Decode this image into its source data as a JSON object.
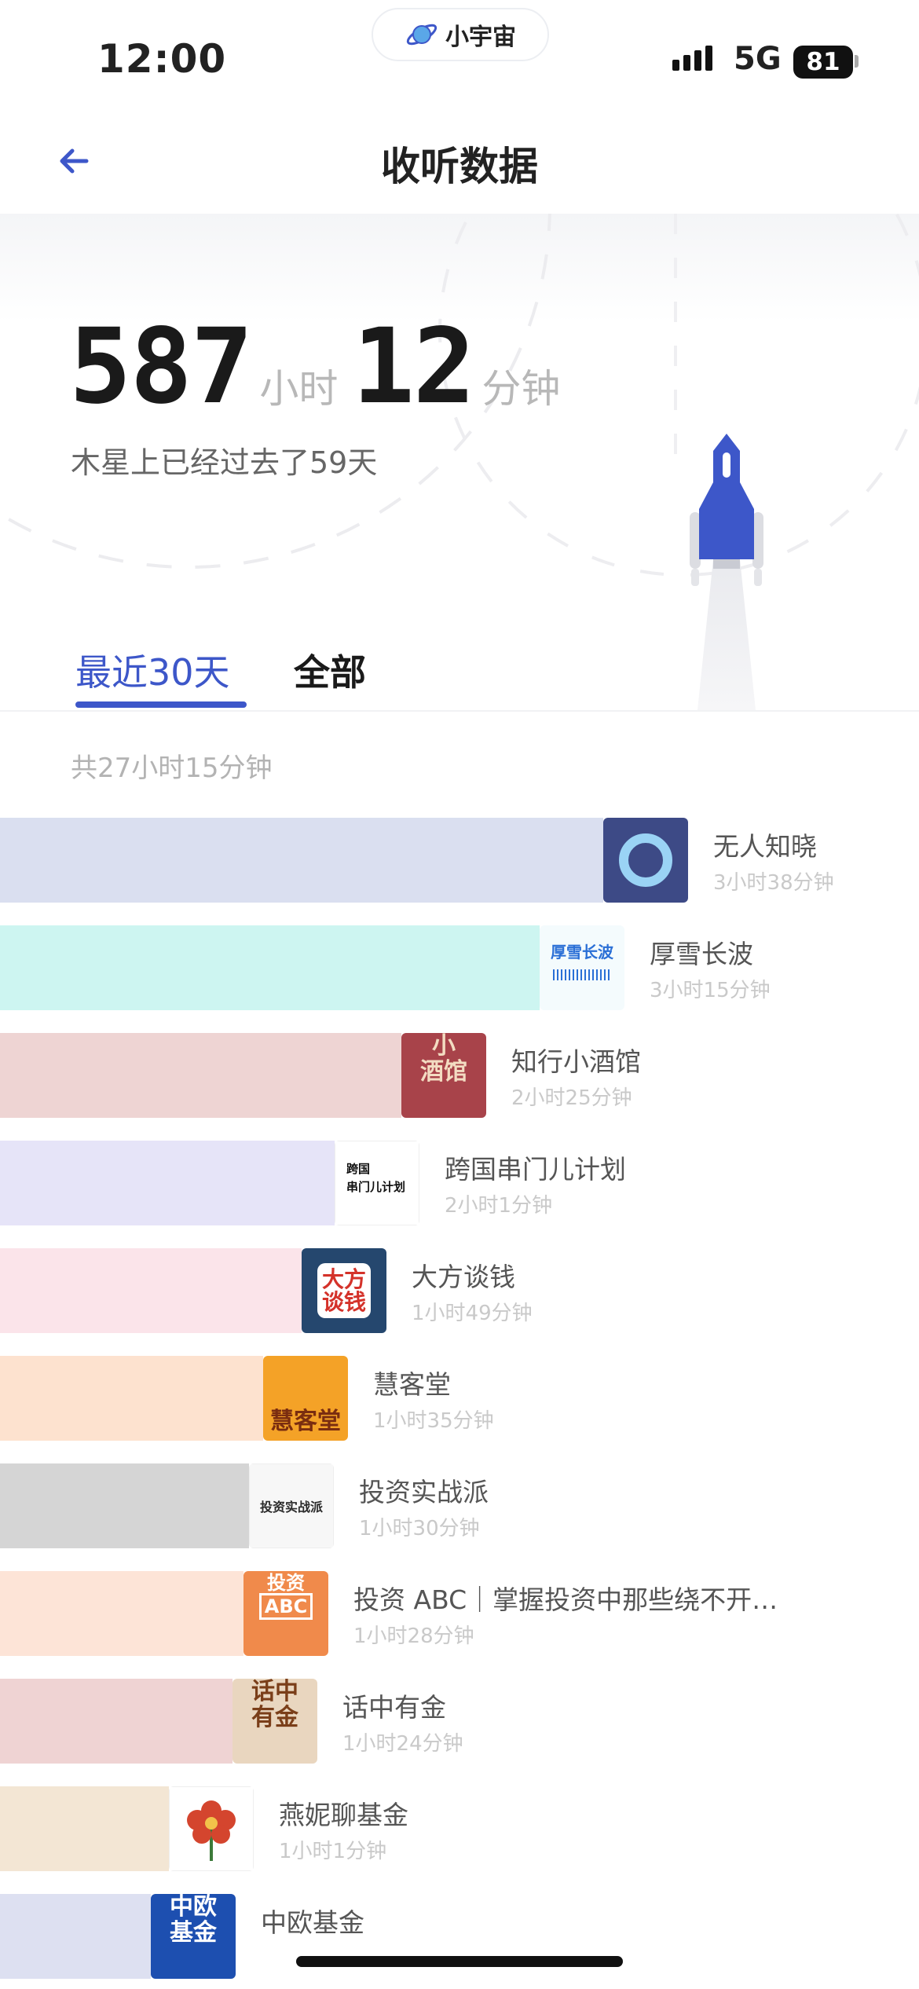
{
  "status": {
    "time": "12:00",
    "network": "5G",
    "battery": "81"
  },
  "island": {
    "app_name": "小宇宙"
  },
  "nav": {
    "title": "收听数据"
  },
  "summary": {
    "hours": "587",
    "hours_unit": "小时",
    "minutes": "12",
    "minutes_unit": "分钟",
    "subtitle": "木星上已经过去了59天"
  },
  "tabs": [
    {
      "label": "最近30天",
      "active": true
    },
    {
      "label": "全部",
      "active": false
    }
  ],
  "total": "共27小时15分钟",
  "podcasts": [
    {
      "name": "无人知晓",
      "duration": "3小时38分钟",
      "share": 1.0,
      "bar_color": "#dadff0",
      "cover": "halo"
    },
    {
      "name": "厚雪长波",
      "duration": "3小时15分钟",
      "share": 0.894,
      "bar_color": "#cdf5f1",
      "cover": "厚雪长波"
    },
    {
      "name": "知行小酒馆",
      "duration": "2小时25分钟",
      "share": 0.665,
      "bar_color": "#eed4d3",
      "cover": "小酒馆"
    },
    {
      "name": "跨国串门儿计划",
      "duration": "2小时1分钟",
      "share": 0.555,
      "bar_color": "#e6e4f8",
      "cover": "跨国串门儿计划"
    },
    {
      "name": "大方谈钱",
      "duration": "1小时49分钟",
      "share": 0.5,
      "bar_color": "#fbe4ea",
      "cover": "大方谈钱"
    },
    {
      "name": "慧客堂",
      "duration": "1小时35分钟",
      "share": 0.436,
      "bar_color": "#fde2cf",
      "cover": "慧客堂"
    },
    {
      "name": "投资实战派",
      "duration": "1小时30分钟",
      "share": 0.413,
      "bar_color": "#d5d5d5",
      "cover": "投资实战派"
    },
    {
      "name": "投资 ABC｜掌握投资中那些绕不开…",
      "duration": "1小时28分钟",
      "share": 0.404,
      "bar_color": "#fde4d7",
      "cover": "投资ABC"
    },
    {
      "name": "话中有金",
      "duration": "1小时24分钟",
      "share": 0.385,
      "bar_color": "#efd3d3",
      "cover": "话中有金"
    },
    {
      "name": "燕妮聊基金",
      "duration": "1小时1分钟",
      "share": 0.28,
      "bar_color": "#f3e6d4",
      "cover": "flower"
    },
    {
      "name": "中欧基金",
      "duration": "",
      "share": 0.25,
      "bar_color": "#dde0f1",
      "cover": "中欧基金"
    }
  ],
  "colors": {
    "accent": "#3d57c9",
    "rocket": "#3d57c9"
  }
}
